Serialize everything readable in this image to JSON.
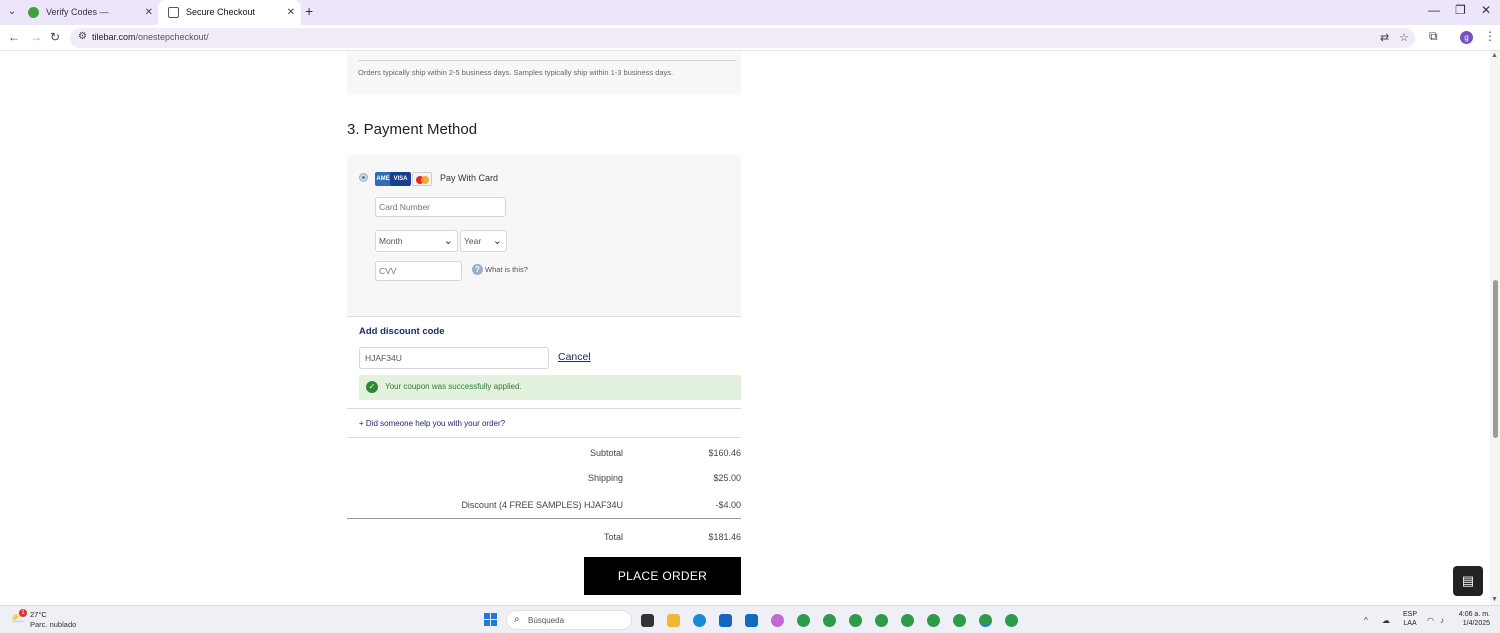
{
  "browser": {
    "tabs": [
      {
        "title": "Verify Codes — SimplyCodes",
        "active": false
      },
      {
        "title": "Secure Checkout",
        "active": true
      }
    ],
    "url_host": "tilebar.com",
    "url_path": "/onestepcheckout/",
    "profile_initial": "g"
  },
  "shipping": {
    "note": "Orders typically ship within 2-5 business days. Samples typically ship within 1-3 business days."
  },
  "payment": {
    "section_title": "3. Payment Method",
    "option_label": "Pay With Card",
    "card_brands": [
      "AMEX",
      "VISA",
      "MC"
    ],
    "card_number_placeholder": "Card Number",
    "month_value": "Month",
    "year_value": "Year",
    "cvv_placeholder": "CVV",
    "cvv_help": "What is this?"
  },
  "discount": {
    "title": "Add discount code",
    "code": "HJAF34U",
    "cancel_label": "Cancel",
    "success_message": "Your coupon was successfully applied."
  },
  "helper_link": "+ Did someone help you with your order?",
  "summary": {
    "subtotal_label": "Subtotal",
    "subtotal_value": "$160.46",
    "shipping_label": "Shipping",
    "shipping_value": "$25.00",
    "discount_label": "Discount (4 FREE SAMPLES) HJAF34U",
    "discount_value": "-$4.00",
    "total_label": "Total",
    "total_value": "$181.46"
  },
  "place_order_label": "PLACE ORDER",
  "taskbar": {
    "weather_temp": "27°C",
    "weather_desc": "Parc. nublado",
    "weather_alert_count": "1",
    "search_placeholder": "Búsqueda",
    "lang_top": "ESP",
    "lang_bottom": "LAA",
    "time": "4:06 a. m.",
    "date": "1/4/2025"
  },
  "colors": {
    "tabbar_bg": "#ede6fb",
    "brand_navy": "#1d2a6b",
    "success_bg": "#e3f1df",
    "success_text": "#2e7d2e",
    "button_bg": "#000000"
  }
}
